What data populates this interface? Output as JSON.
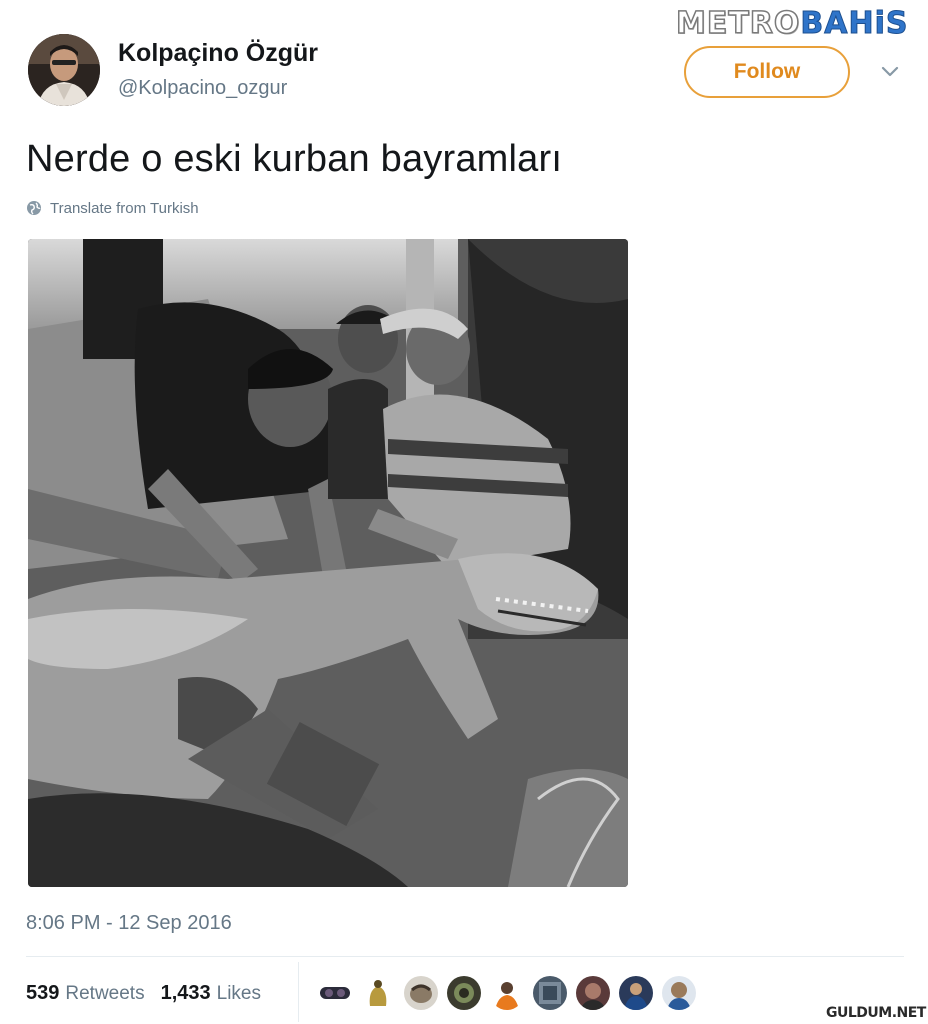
{
  "watermark": {
    "metro": "METRO",
    "bahis": "BAHiS",
    "bottom": "GULDUM.NET"
  },
  "author": {
    "display_name": "Kolpaçino Özgür",
    "handle": "@Kolpacino_ozgur"
  },
  "actions": {
    "follow_label": "Follow"
  },
  "tweet": {
    "text": "Nerde o eski kurban bayramları",
    "translate_label": "Translate from Turkish",
    "timestamp": "8:06 PM - 12 Sep 2016"
  },
  "stats": {
    "retweets_count": "539",
    "retweets_label": "Retweets",
    "likes_count": "1,433",
    "likes_label": "Likes"
  },
  "likers_count": 9,
  "colors": {
    "follow": "#e08a1e",
    "secondary_text": "#657786",
    "brand_blue": "#2f74c9"
  },
  "icons": {
    "caret": "chevron-down-icon",
    "translate": "globe-icon"
  }
}
